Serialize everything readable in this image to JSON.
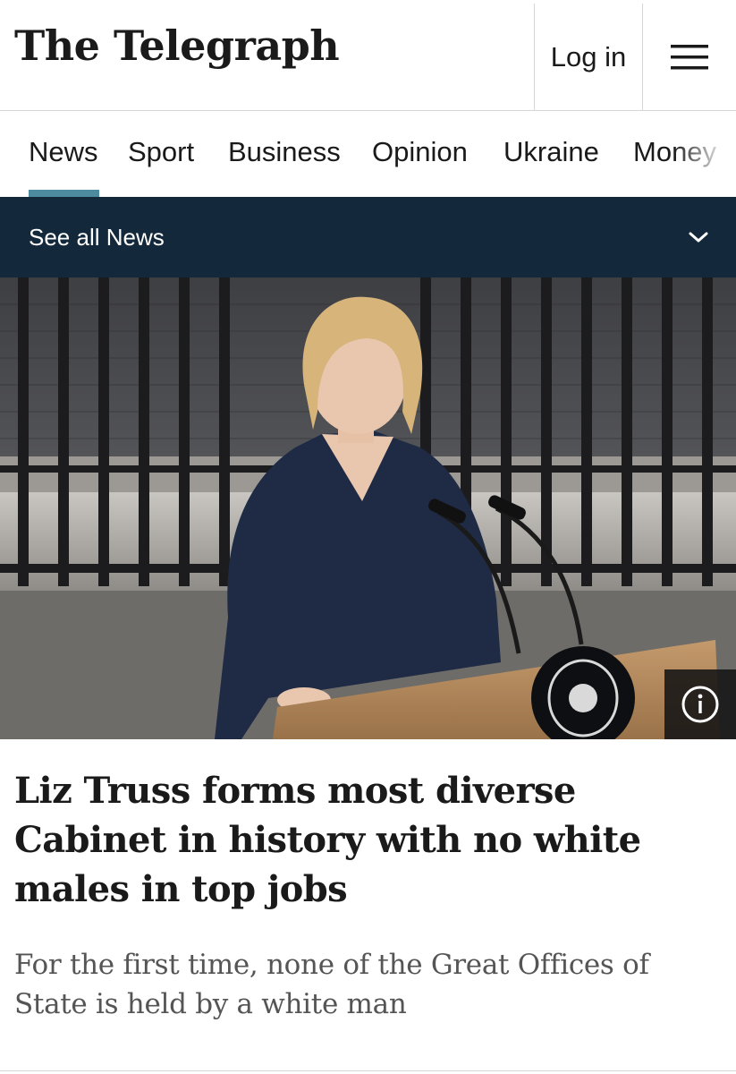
{
  "header": {
    "logo_text": "The Telegraph",
    "login_label": "Log in",
    "menu_icon": "hamburger-menu-icon"
  },
  "nav": {
    "items": [
      {
        "label": "News",
        "active": true
      },
      {
        "label": "Sport",
        "active": false
      },
      {
        "label": "Business",
        "active": false
      },
      {
        "label": "Opinion",
        "active": false
      },
      {
        "label": "Ukraine",
        "active": false
      },
      {
        "label": "Money",
        "active": false
      }
    ],
    "active_color": "#4d8c9f"
  },
  "see_all": {
    "label": "See all News",
    "background": "#13283a",
    "icon": "chevron-down-icon"
  },
  "hero": {
    "info_icon": "info-icon"
  },
  "article": {
    "headline": "Liz Truss forms most diverse Cabinet in history with no white males in top jobs",
    "standfirst": "For the first time, none of the Great Offices of State is held by a white man"
  }
}
